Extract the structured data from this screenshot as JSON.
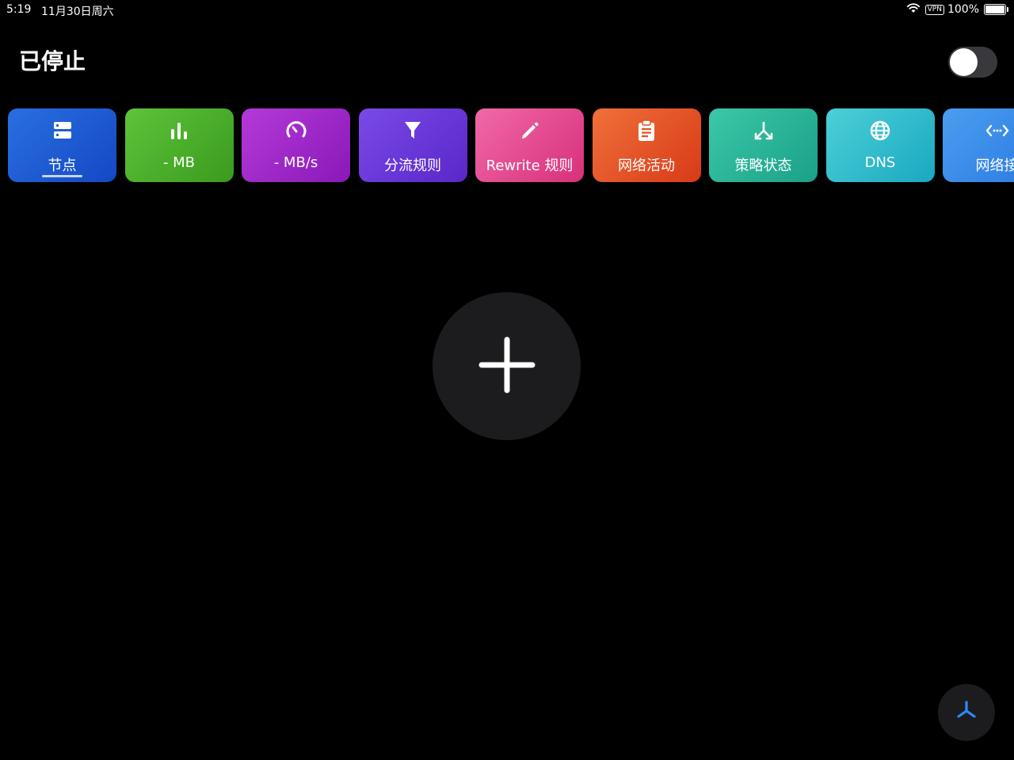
{
  "status_bar": {
    "time": "5:19",
    "date": "11月30日周六",
    "vpn": "VPN",
    "battery": "100%",
    "battery_level": 1.0
  },
  "header": {
    "title": "已停止",
    "toggle_on": false
  },
  "tiles": [
    {
      "label": "节点",
      "icon": "server-icon",
      "color_from": "#2a6fe0",
      "color_to": "#1448c4"
    },
    {
      "label": "- MB",
      "icon": "bar-chart-icon",
      "color_from": "#5ec43a",
      "color_to": "#3a9a1e"
    },
    {
      "label": "- MB/s",
      "icon": "speedometer-icon",
      "color_from": "#b43ad8",
      "color_to": "#8a18b8"
    },
    {
      "label": "分流规则",
      "icon": "filter-icon",
      "color_from": "#7a4ae8",
      "color_to": "#5a26c8"
    },
    {
      "label": "Rewrite 规则",
      "icon": "pencil-icon",
      "color_from": "#f069a8",
      "color_to": "#d8307a"
    },
    {
      "label": "网络活动",
      "icon": "clipboard-icon",
      "color_from": "#f0703a",
      "color_to": "#d83a18"
    },
    {
      "label": "策略状态",
      "icon": "branch-icon",
      "color_from": "#3cc8a8",
      "color_to": "#1aa088"
    },
    {
      "label": "DNS",
      "icon": "globe-icon",
      "color_from": "#4cd0d8",
      "color_to": "#1aa8c0"
    },
    {
      "label": "网络接",
      "icon": "code-arrows-icon",
      "color_from": "#4a9ef0",
      "color_to": "#2a78e0"
    }
  ],
  "colors": {
    "background": "#000000",
    "button_bg": "#1c1c1e",
    "fab_accent": "#2a8cff"
  }
}
